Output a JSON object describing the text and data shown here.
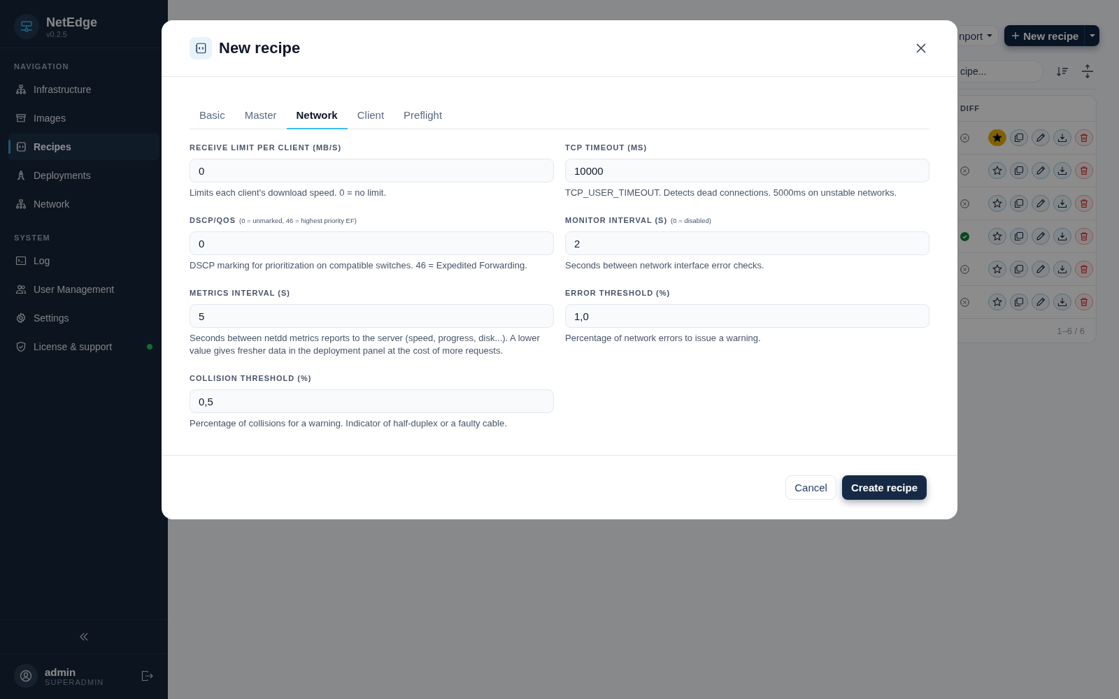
{
  "sidebar": {
    "app_name": "NetEdge",
    "version": "v0.2.5",
    "sections": [
      {
        "title": "NAVIGATION",
        "items": [
          {
            "label": "Infrastructure",
            "kind": "tree",
            "selected": false
          },
          {
            "label": "Images",
            "kind": "archive",
            "selected": false
          },
          {
            "label": "Recipes",
            "kind": "recipe",
            "selected": true
          },
          {
            "label": "Deployments",
            "kind": "rocket",
            "selected": false
          },
          {
            "label": "Network",
            "kind": "tree",
            "selected": false
          }
        ]
      },
      {
        "title": "SYSTEM",
        "items": [
          {
            "label": "Log",
            "kind": "terminal",
            "selected": false
          },
          {
            "label": "User Management",
            "kind": "users",
            "selected": false
          },
          {
            "label": "Settings",
            "kind": "gear",
            "selected": false
          },
          {
            "label": "License & support",
            "kind": "shield",
            "selected": false,
            "online": true
          }
        ]
      }
    ],
    "user": {
      "name": "admin",
      "role": "SUPERADMIN"
    }
  },
  "background": {
    "import_button": "nport",
    "new_recipe_button": "New recipe",
    "search": {
      "placeholder": "cipe..."
    },
    "column": "DIFF",
    "rows": [
      {
        "diff_ok": false,
        "favorite": true
      },
      {
        "diff_ok": false,
        "favorite": false
      },
      {
        "diff_ok": false,
        "favorite": false
      },
      {
        "diff_ok": true,
        "favorite": false
      },
      {
        "diff_ok": false,
        "favorite": false
      },
      {
        "diff_ok": false,
        "favorite": false
      }
    ],
    "pagination": "1–6 / 6"
  },
  "dialog": {
    "title": "New recipe",
    "tabs": [
      {
        "label": "Basic",
        "selected": false
      },
      {
        "label": "Master",
        "selected": false
      },
      {
        "label": "Network",
        "selected": true
      },
      {
        "label": "Client",
        "selected": false
      },
      {
        "label": "Preflight",
        "selected": false
      }
    ],
    "fields": [
      {
        "label": "RECEIVE LIMIT PER CLIENT (MB/S)",
        "value": "0",
        "help": "Limits each client's download speed. 0 = no limit."
      },
      {
        "label": "TCP TIMEOUT (MS)",
        "value": "10000",
        "help": "TCP_USER_TIMEOUT. Detects dead connections. 5000ms on unstable networks."
      },
      {
        "label": "DSCP/QOS",
        "hint": "(0 = unmarked, 46 = highest priority EF)",
        "value": "0",
        "help": "DSCP marking for prioritization on compatible switches. 46 = Expedited Forwarding."
      },
      {
        "label": "MONITOR INTERVAL (S)",
        "hint": "(0 = disabled)",
        "value": "2",
        "help": "Seconds between network interface error checks."
      },
      {
        "label": "METRICS INTERVAL (S)",
        "value": "5",
        "help": "Seconds between netdd metrics reports to the server (speed, progress, disk...). A lower value gives fresher data in the deployment panel at the cost of more requests."
      },
      {
        "label": "ERROR THRESHOLD (%)",
        "value": "1,0",
        "help": "Percentage of network errors to issue a warning."
      },
      {
        "label": "COLLISION THRESHOLD (%)",
        "value": "0,5",
        "help": "Percentage of collisions for a warning. Indicator of half-duplex or a faulty cable."
      }
    ],
    "buttons": {
      "cancel": "Cancel",
      "create": "Create recipe"
    }
  }
}
